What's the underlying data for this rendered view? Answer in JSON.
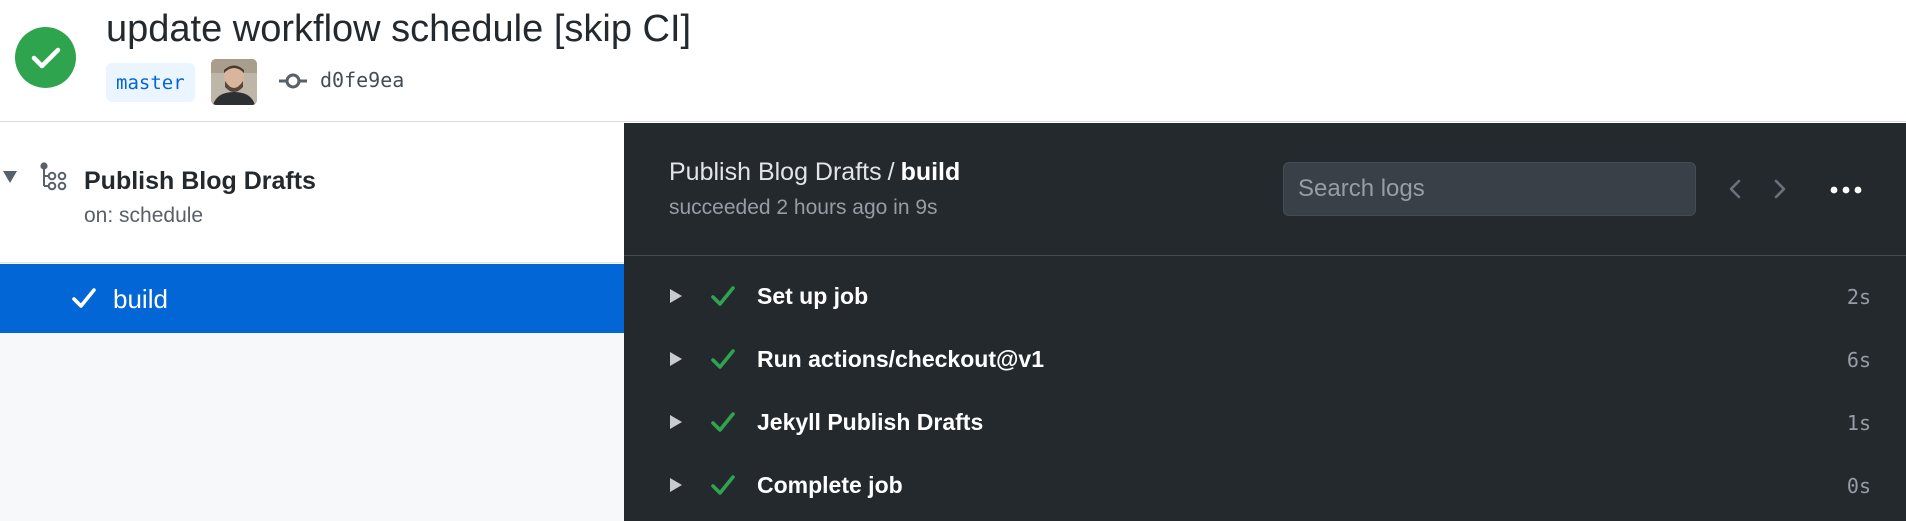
{
  "run": {
    "title": "update workflow schedule [skip CI]",
    "branch": "master",
    "commit_sha": "d0fe9ea",
    "status_color": "#2ea44f"
  },
  "sidebar": {
    "workflow_name": "Publish Blog Drafts",
    "workflow_trigger": "on: schedule",
    "jobs": [
      {
        "label": "build",
        "status": "success",
        "selected": true
      }
    ]
  },
  "logs": {
    "workflow_name": "Publish Blog Drafts",
    "separator": "/",
    "job_name": "build",
    "summary": "succeeded 2 hours ago in 9s",
    "search_placeholder": "Search logs",
    "steps": [
      {
        "name": "Set up job",
        "duration": "2s"
      },
      {
        "name": "Run actions/checkout@v1",
        "duration": "6s"
      },
      {
        "name": "Jekyll Publish Drafts",
        "duration": "1s"
      },
      {
        "name": "Complete job",
        "duration": "0s"
      }
    ]
  },
  "icons": {
    "status": "check-circle-icon",
    "commit": "git-commit-icon",
    "workflow": "workflow-icon",
    "caret": "triangle-icon",
    "check": "check-icon",
    "prev": "chevron-left-icon",
    "next": "chevron-right-icon",
    "more": "kebab-horizontal-icon"
  },
  "colors": {
    "success": "#2ea44f",
    "selected_bg": "#0366d6",
    "log_bg": "#24292e"
  }
}
